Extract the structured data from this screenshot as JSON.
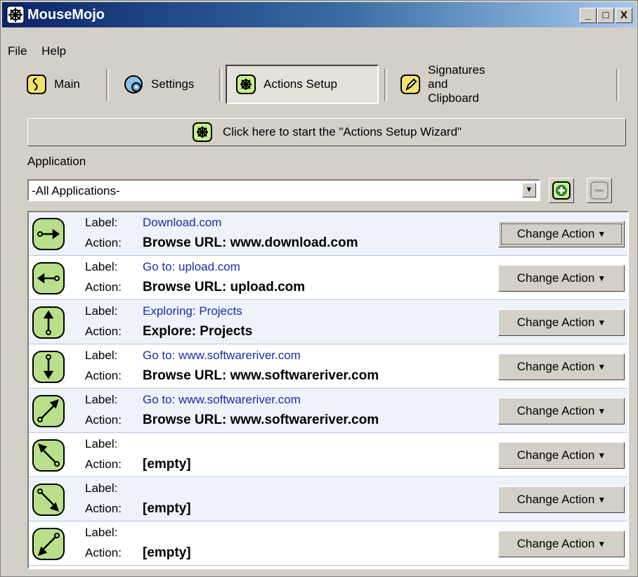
{
  "window": {
    "title": "MouseMojo",
    "minimize": "_",
    "maximize": "□",
    "close": "X"
  },
  "menu": [
    "File",
    "Help"
  ],
  "tabs": [
    {
      "label": "Main",
      "icon": "main-icon"
    },
    {
      "label": "Settings",
      "icon": "settings-icon"
    },
    {
      "label": "Actions Setup",
      "icon": "actions-setup-icon",
      "active": true
    },
    {
      "label": "Signatures and Clipboard",
      "icon": "signatures-icon"
    }
  ],
  "wizard_label": "Click here to start the \"Actions Setup Wizard\"",
  "application": {
    "label": "Application",
    "selected": "-All Applications-"
  },
  "field_labels": {
    "label": "Label:",
    "action": "Action:"
  },
  "change_action_label": "Change Action",
  "rows": [
    {
      "gesture": "right-arrow-gesture",
      "label": "Download.com",
      "action": "Browse URL: www.download.com"
    },
    {
      "gesture": "left-arrow-gesture",
      "label": "Go to: upload.com",
      "action": "Browse URL: upload.com"
    },
    {
      "gesture": "up-arrow-gesture",
      "label": "Exploring: Projects",
      "action": "Explore: Projects"
    },
    {
      "gesture": "down-arrow-gesture",
      "label": "Go to: www.softwareriver.com",
      "action": "Browse URL: www.softwareriver.com"
    },
    {
      "gesture": "up-right-arrow-gesture",
      "label": "Go to: www.softwareriver.com",
      "action": "Browse URL: www.softwareriver.com"
    },
    {
      "gesture": "up-left-arrow-gesture",
      "label": "",
      "action": "[empty]"
    },
    {
      "gesture": "down-right-arrow-gesture",
      "label": "",
      "action": "[empty]"
    },
    {
      "gesture": "down-left-arrow-gesture",
      "label": "",
      "action": "[empty]"
    }
  ],
  "colors": {
    "title_start": "#0a246a",
    "title_end": "#a6caf0",
    "label_text": "#1a2ea8",
    "icon_green": "#b8e08a"
  }
}
